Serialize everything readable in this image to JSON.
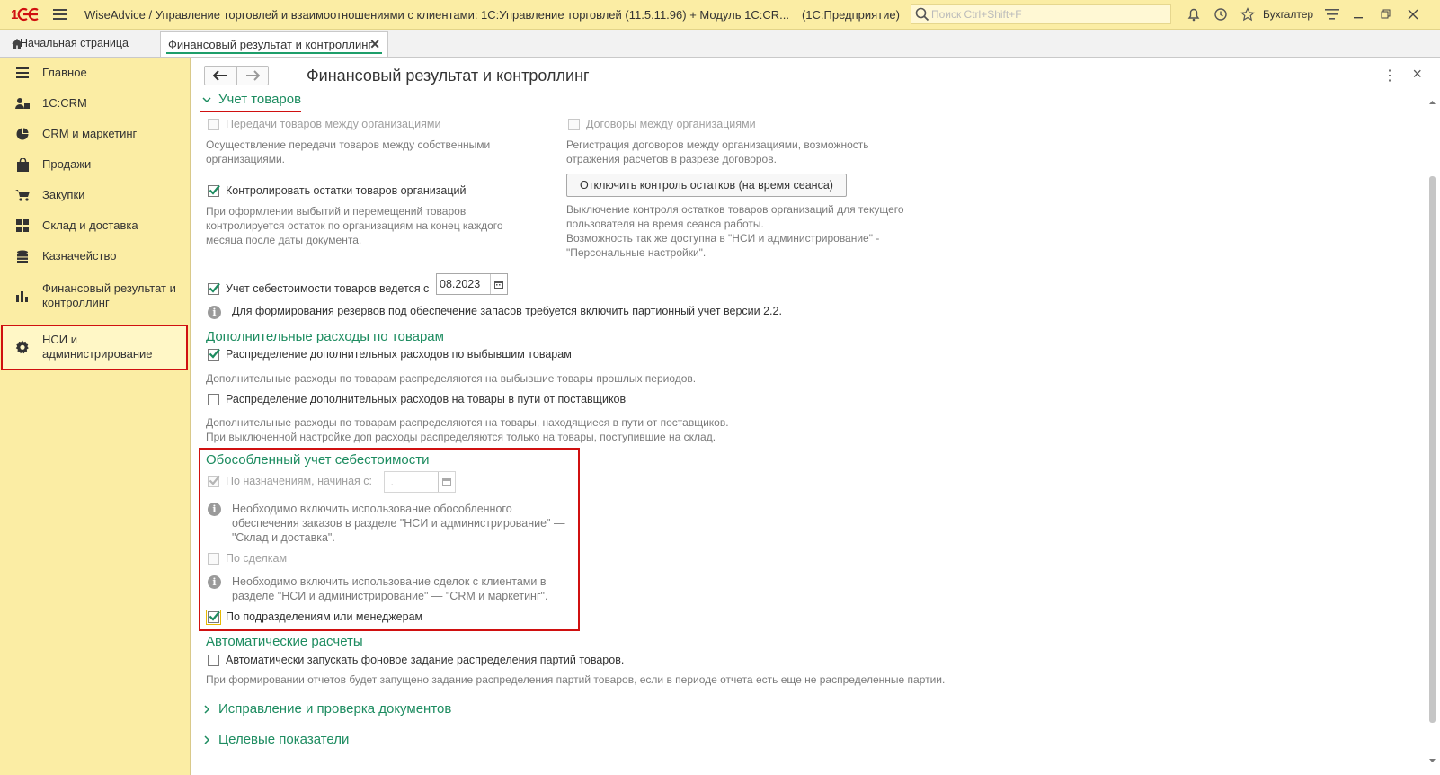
{
  "window": {
    "title": "WiseAdvice / Управление торговлей и взаимоотношениями с клиентами: 1С:Управление торговлей (11.5.11.96) + Модуль 1С:CR...",
    "mode": "(1С:Предприятие)",
    "search_placeholder": "Поиск Ctrl+Shift+F",
    "user": "Бухгалтер"
  },
  "tabs": {
    "home": "Начальная страница",
    "active": "Финансовый результат и контроллинг"
  },
  "sidebar": {
    "items": [
      {
        "label": "Главное",
        "icon": "list-icon"
      },
      {
        "label": "1C:CRM",
        "icon": "users-icon"
      },
      {
        "label": "CRM и маркетинг",
        "icon": "pie-chart-icon"
      },
      {
        "label": "Продажи",
        "icon": "bag-icon"
      },
      {
        "label": "Закупки",
        "icon": "cart-icon"
      },
      {
        "label": "Склад и доставка",
        "icon": "warehouse-icon"
      },
      {
        "label": "Казначейство",
        "icon": "coins-icon"
      },
      {
        "label": "Финансовый результат и контроллинг",
        "icon": "bar-chart-icon"
      },
      {
        "label": "НСИ и администрирование",
        "icon": "gear-icon"
      }
    ],
    "selected_index": 8
  },
  "form": {
    "title": "Финансовый результат и контроллинг",
    "group_goods": "Учет товаров",
    "transfer_label": "Передачи товаров между организациями",
    "transfer_desc": "Осуществление передачи товаров между собственными организациями.",
    "contracts_label": "Договоры между организациями",
    "contracts_desc": "Регистрация договоров между организациями, возможность отражения расчетов  в разрезе договоров.",
    "control_label": "Контролировать остатки товаров организаций",
    "control_desc": "При оформлении выбытий и перемещений товаров контролируется остаток по организациям на конец каждого месяца после даты документа.",
    "disable_btn": "Отключить контроль остатков (на время сеанса)",
    "disable_desc": "Выключение контроля остатков товаров организаций для текущего пользователя на время сеанса работы.\n Возможность так же доступна в \"НСИ и администрирование\" - \"Персональные настройки\".",
    "cost_label": "Учет себестоимости товаров ведется с",
    "cost_date": "08.2023",
    "reserves_note": "Для формирования резервов под обеспечение запасов требуется включить партионный учет версии 2.2.",
    "extra_head": "Дополнительные расходы по товарам",
    "extra1_label": "Распределение дополнительных расходов по выбывшим товарам",
    "extra1_desc": "Дополнительные расходы по товарам распределяются на выбывшие товары прошлых периодов.",
    "extra2_label": "Распределение дополнительных расходов на товары в пути от поставщиков",
    "extra2_desc": "Дополнительные расходы по товарам распределяются на товары, находящиеся в пути от поставщиков.\nПри выключенной настройке доп расходы распределяются только на товары, поступившие на склад.",
    "separate_head": "Обособленный учет себестоимости",
    "purpose_label": "По назначениям, начиная с:",
    "purpose_date": " .",
    "purpose_note": "Необходимо включить использование обособленного обеспечения заказов в разделе \"НСИ и администрирование\" — \"Склад и доставка\".",
    "deals_label": "По сделкам",
    "deals_note": "Необходимо включить использование сделок с клиентами в разделе \"НСИ и администрирование\" — \"CRM и маркетинг\".",
    "depts_label": "По подразделениям или менеджерам",
    "auto_head": "Автоматические расчеты",
    "auto_label": "Автоматически запускать фоновое задание распределения партий товаров.",
    "auto_desc": "При формировании отчетов будет запущено задание распределения партий товаров, если в периоде отчета есть еще не распределенные партии.",
    "group_fix": "Исправление и проверка документов",
    "group_targets": "Целевые показатели"
  },
  "checkboxes": {
    "transfer": false,
    "contracts": false,
    "control": true,
    "cost": true,
    "extra1": true,
    "extra2": false,
    "purpose": true,
    "deals": false,
    "depts": true,
    "auto": false
  },
  "colors": {
    "accent_green": "#1d8c60",
    "panel_yellow": "#fbeda4",
    "highlight_red": "#d01010"
  }
}
